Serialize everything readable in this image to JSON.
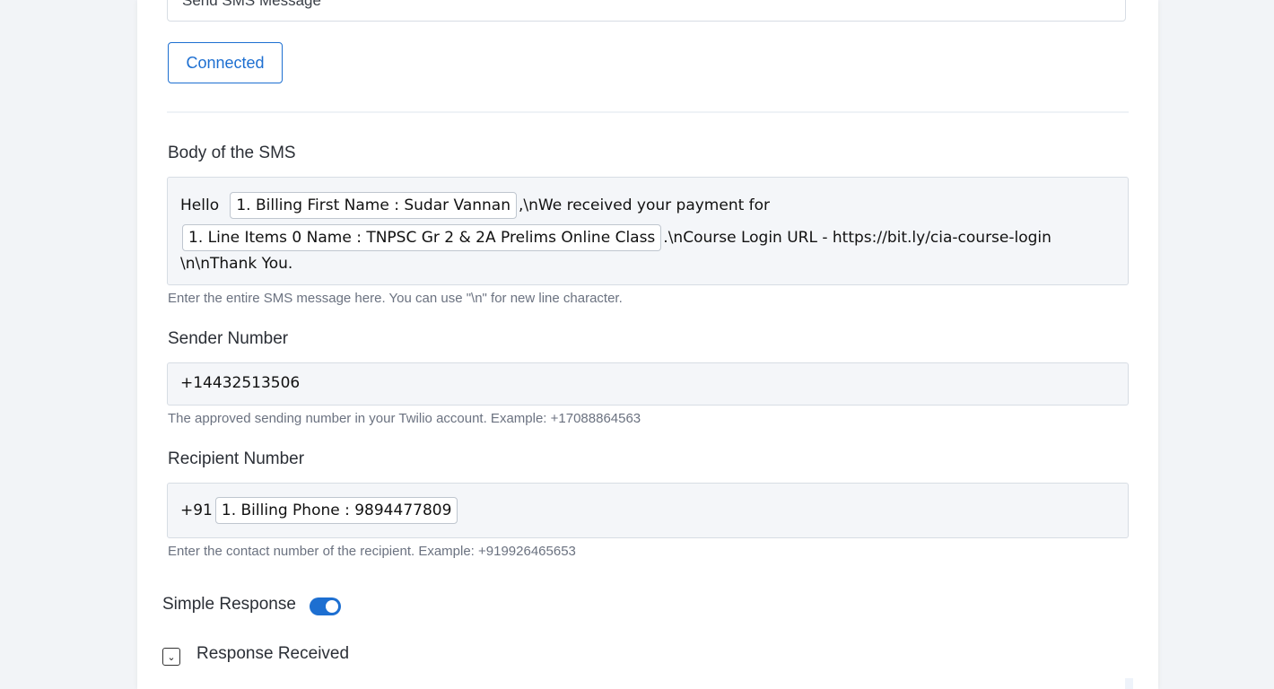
{
  "action_select": {
    "value": "Send SMS Message"
  },
  "connection_button": {
    "label": "Connected"
  },
  "body_field": {
    "label": "Body of the SMS",
    "text_hello": "Hello",
    "token_first_name": "1. Billing First Name : Sudar Vannan",
    "text_after_name": ",\\nWe received your payment for",
    "token_line_item": "1. Line Items 0 Name : TNPSC Gr 2 & 2A Prelims Online Class",
    "text_after_item": ".\\nCourse Login URL - https://bit.ly/cia-course-login",
    "text_thanks": "\\n\\nThank You.",
    "help": "Enter the entire SMS message here. You can use \"\\n\" for new line character."
  },
  "sender_field": {
    "label": "Sender Number",
    "value": "+14432513506",
    "help": "The approved sending number in your Twilio account. Example: +17088864563"
  },
  "recipient_field": {
    "label": "Recipient Number",
    "prefix": "+91",
    "token_phone": "1. Billing Phone : 9894477809",
    "help": "Enter the contact number of the recipient. Example: +919926465653"
  },
  "simple_response": {
    "label": "Simple Response",
    "enabled": true
  },
  "response_received": {
    "label": "Response Received"
  },
  "colors": {
    "accent": "#1d6fd1",
    "field_bg": "#f4f6f9",
    "page_bg": "#f2f4f7"
  }
}
